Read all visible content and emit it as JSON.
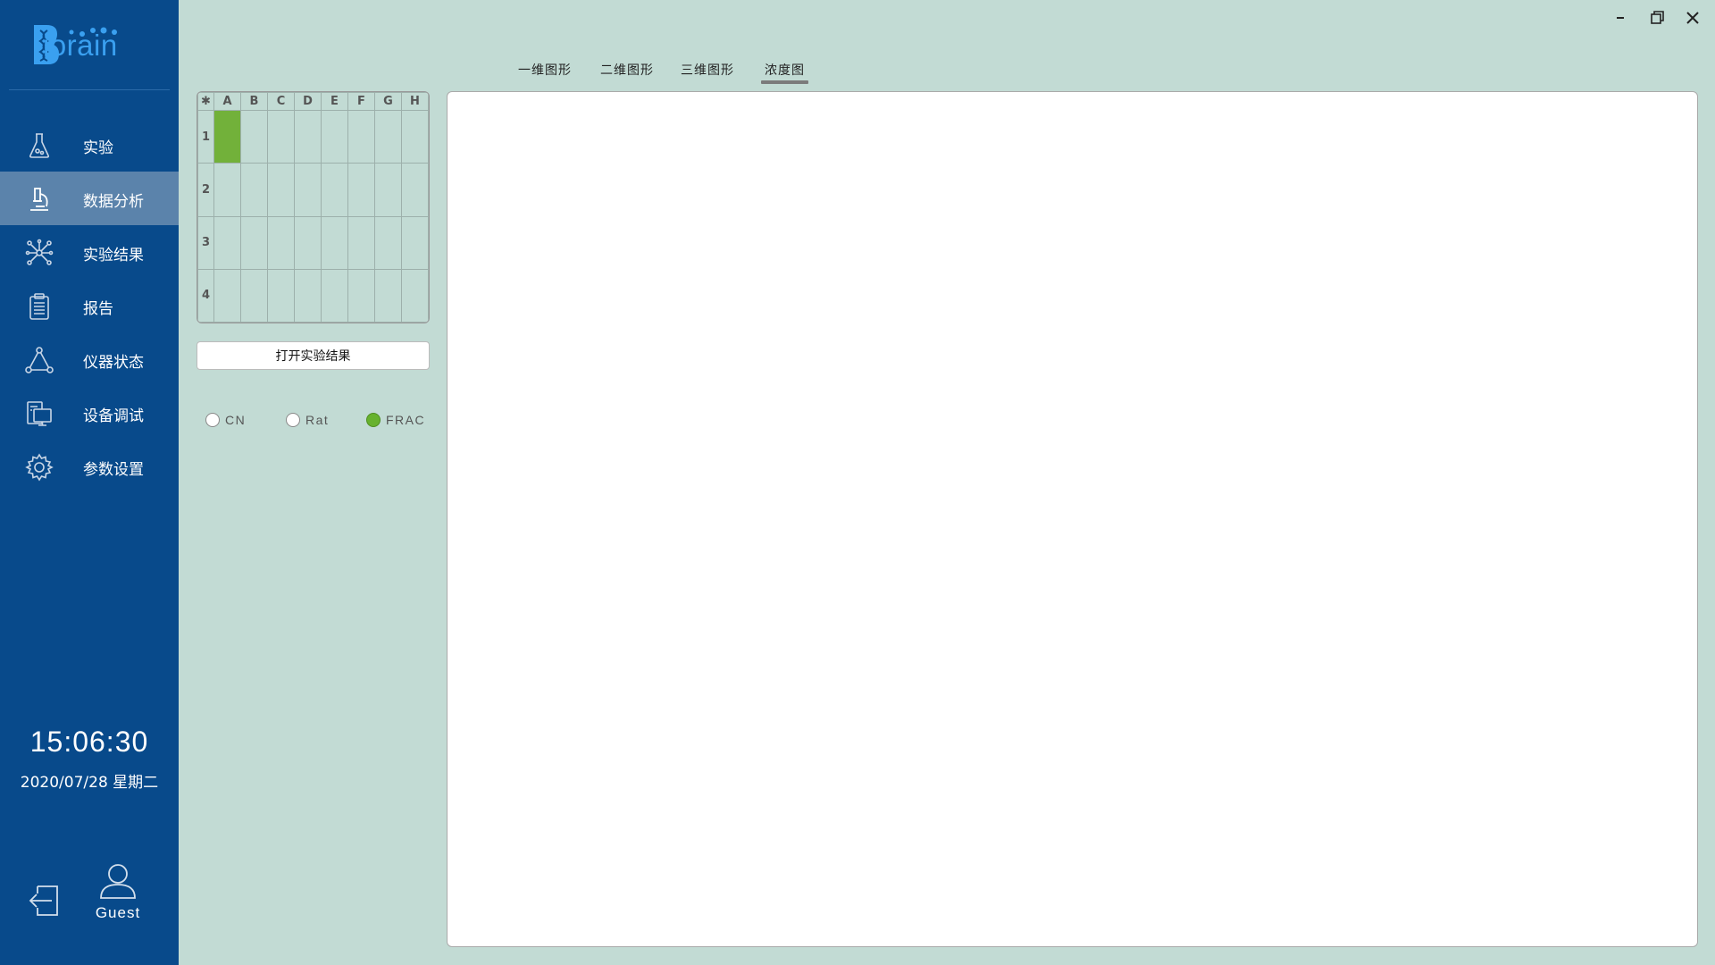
{
  "app": {
    "logo_text": "iorain",
    "brand_color": "#3aa0f0",
    "sidebar_color": "#084a8b",
    "active_color": "#5b83ab"
  },
  "sidebar": {
    "items": [
      {
        "label": "实验",
        "icon": "flask-icon",
        "active": false
      },
      {
        "label": "数据分析",
        "icon": "microscope-icon",
        "active": true
      },
      {
        "label": "实验结果",
        "icon": "network-icon",
        "active": false
      },
      {
        "label": "报告",
        "icon": "clipboard-icon",
        "active": false
      },
      {
        "label": "仪器状态",
        "icon": "triangle-nodes-icon",
        "active": false
      },
      {
        "label": "设备调试",
        "icon": "devices-icon",
        "active": false
      },
      {
        "label": "参数设置",
        "icon": "gear-icon",
        "active": false
      }
    ],
    "clock_time": "15:06:30",
    "clock_date": "2020/07/28 星期二",
    "user_name": "Guest"
  },
  "tabs": [
    {
      "label": "一维图形",
      "active": false
    },
    {
      "label": "二维图形",
      "active": false
    },
    {
      "label": "三维图形",
      "active": false
    },
    {
      "label": "浓度图",
      "active": true
    }
  ],
  "plate": {
    "corner": "✱",
    "columns": [
      "A",
      "B",
      "C",
      "D",
      "E",
      "F",
      "G",
      "H"
    ],
    "rows": [
      "1",
      "2",
      "3",
      "4"
    ],
    "selected_well": "A1",
    "selected_color": "#72b13a"
  },
  "open_button_label": "打开实验结果",
  "radios": [
    {
      "label": "CN",
      "checked": false
    },
    {
      "label": "Rat",
      "checked": false
    },
    {
      "label": "FRAC",
      "checked": true
    }
  ]
}
